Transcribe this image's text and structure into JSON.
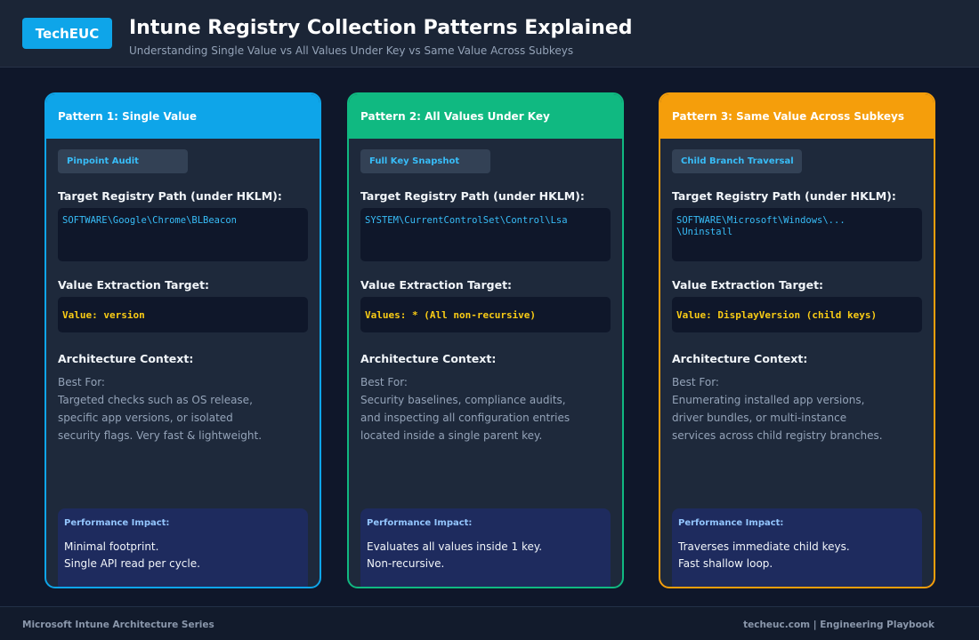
{
  "header": {
    "logo": "TechEUC",
    "title": "Intune Registry Collection Patterns Explained",
    "subtitle": "Understanding Single Value vs All Values Under Key vs Same Value Across Subkeys"
  },
  "colors": {
    "pattern1": "#0ea5e9",
    "pattern2": "#10b981",
    "pattern3": "#f59e0b",
    "code_path": "#38bdf8",
    "code_value": "#facc15"
  },
  "cards": [
    {
      "header": "Pattern 1: Single Value",
      "tag": "Pinpoint Audit",
      "path_label": "Target Registry Path (under HKLM):",
      "path_lines": [
        "SOFTWARE\\Google\\Chrome\\BLBeacon"
      ],
      "value_label": "Value Extraction Target:",
      "value": "Value: version",
      "context_label": "Architecture Context:",
      "desc_lines": [
        "Best For:",
        "Targeted checks such as OS release,",
        "specific app versions, or isolated",
        "security flags. Very fast & lightweight."
      ],
      "perf_title": "Performance Impact:",
      "perf_lines": [
        "Minimal footprint.",
        "Single API read per cycle."
      ]
    },
    {
      "header": "Pattern 2: All Values Under Key",
      "tag": "Full Key Snapshot",
      "path_label": "Target Registry Path (under HKLM):",
      "path_lines": [
        "SYSTEM\\CurrentControlSet\\Control\\Lsa"
      ],
      "value_label": "Value Extraction Target:",
      "value": "Values: * (All non-recursive)",
      "context_label": "Architecture Context:",
      "desc_lines": [
        "Best For:",
        "Security baselines, compliance audits,",
        "and inspecting all configuration entries",
        "located inside a single parent key."
      ],
      "perf_title": "Performance Impact:",
      "perf_lines": [
        "Evaluates all values inside 1 key.",
        "Non-recursive."
      ]
    },
    {
      "header": "Pattern 3: Same Value Across Subkeys",
      "tag": "Child Branch Traversal",
      "path_label": "Target Registry Path (under HKLM):",
      "path_lines": [
        "SOFTWARE\\Microsoft\\Windows\\...",
        "\\Uninstall"
      ],
      "value_label": "Value Extraction Target:",
      "value": "Value: DisplayVersion (child keys)",
      "context_label": "Architecture Context:",
      "desc_lines": [
        "Best For:",
        "Enumerating installed app versions,",
        "driver bundles, or multi-instance",
        "services across child registry branches."
      ],
      "perf_title": "Performance Impact:",
      "perf_lines": [
        "Traverses immediate child keys.",
        "Fast shallow loop."
      ]
    }
  ],
  "footer": {
    "left": "Microsoft Intune Architecture Series",
    "right": "techeuc.com | Engineering Playbook"
  }
}
